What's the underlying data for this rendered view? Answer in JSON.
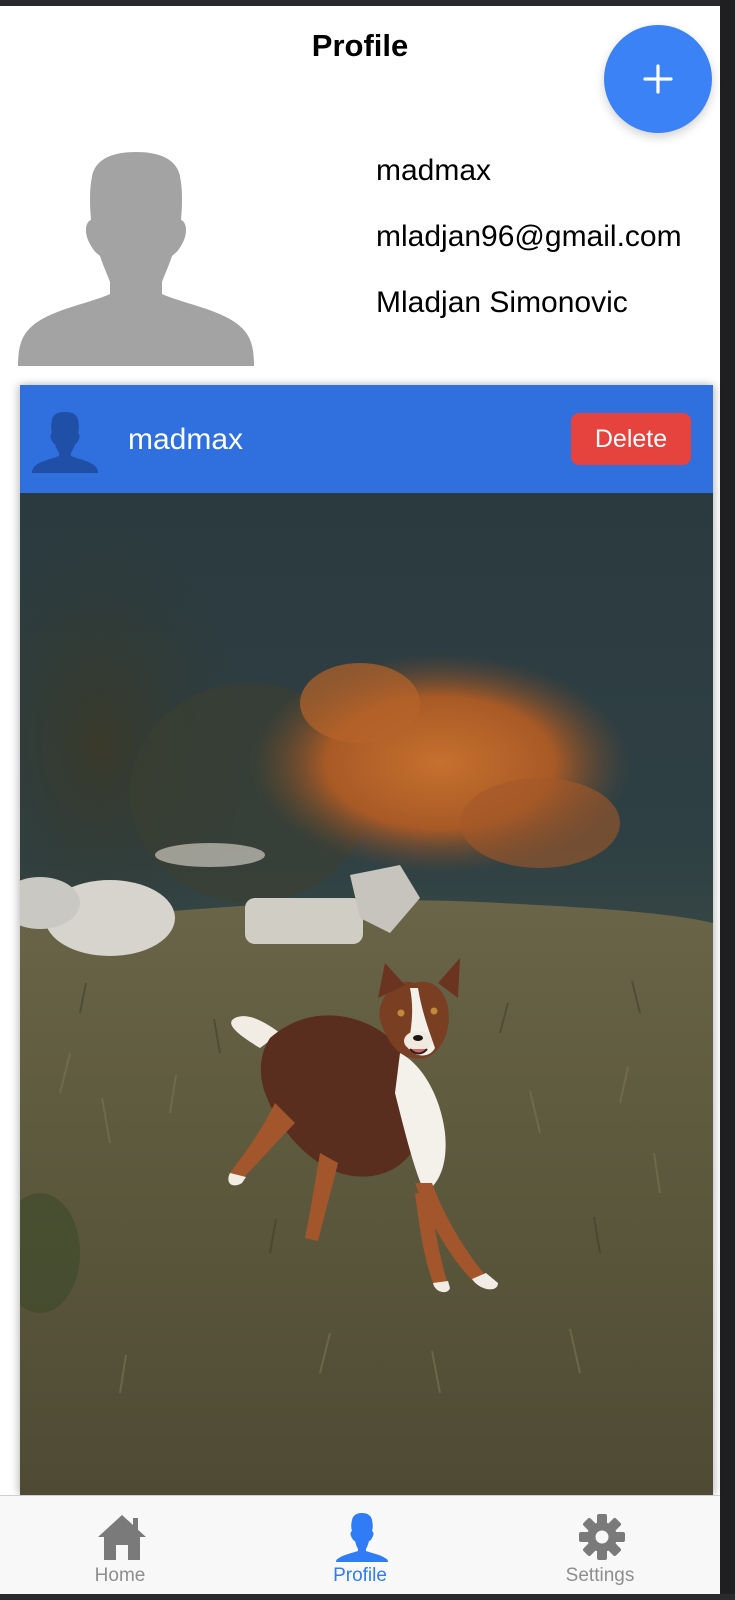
{
  "header": {
    "title": "Profile",
    "add_icon": "plus-icon"
  },
  "profile": {
    "avatar_icon": "person-silhouette-icon",
    "username": "madmax",
    "email": "mladjan96@gmail.com",
    "full_name": "Mladjan Simonovic"
  },
  "post": {
    "avatar_icon": "person-silhouette-icon",
    "username": "madmax",
    "delete_label": "Delete",
    "image_subject": "dog-running-in-meadow-photo"
  },
  "tabs": [
    {
      "label": "Home",
      "icon": "home-icon",
      "active": false
    },
    {
      "label": "Profile",
      "icon": "person-icon",
      "active": true
    },
    {
      "label": "Settings",
      "icon": "gear-icon",
      "active": false
    }
  ],
  "colors": {
    "accent": "#3b82f6",
    "post_header": "#2f6fde",
    "delete": "#e6423e",
    "tab_active": "#2f7cf6",
    "tab_inactive": "#8e8e8e",
    "avatar_gray": "#a3a3a3"
  }
}
